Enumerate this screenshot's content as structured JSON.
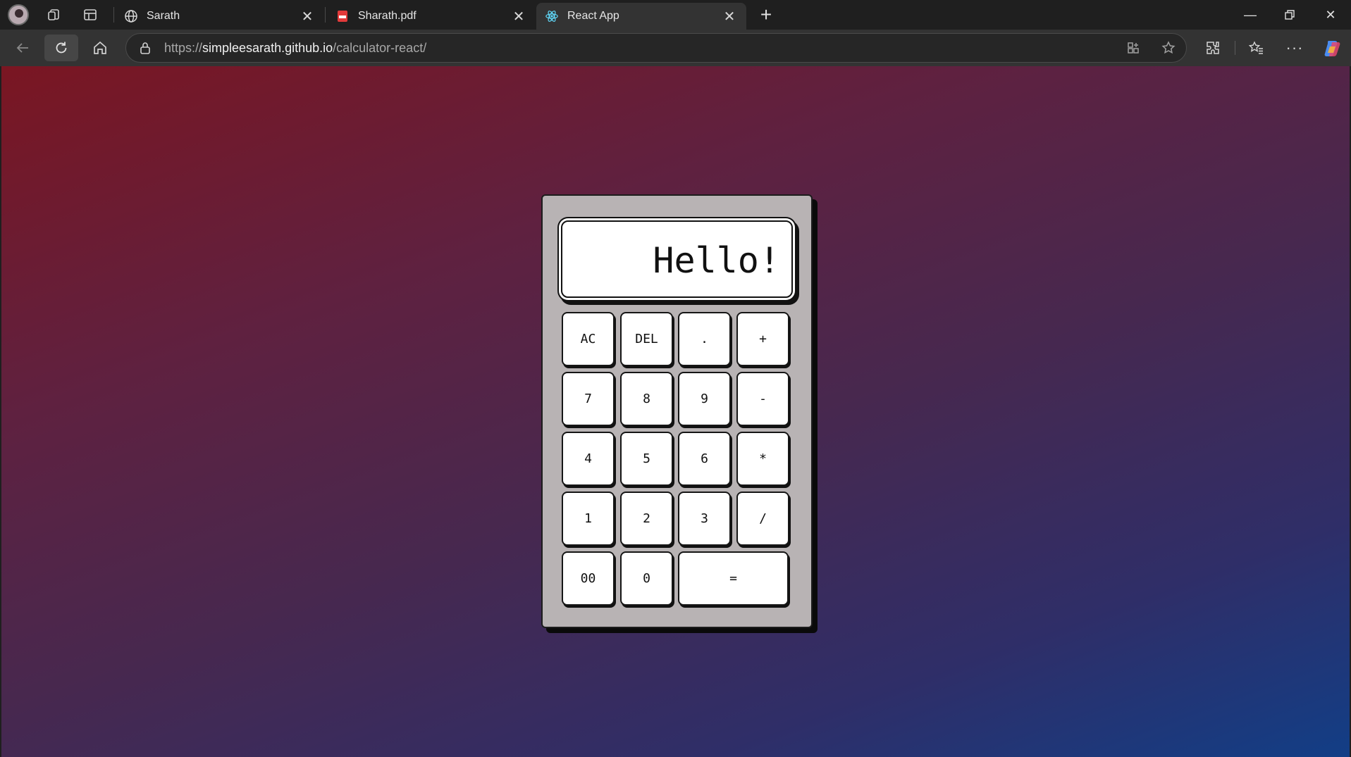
{
  "browser": {
    "tabs": [
      {
        "label": "Sarath",
        "icon": "globe-icon"
      },
      {
        "label": "Sharath.pdf",
        "icon": "pdf-icon"
      },
      {
        "label": "React App",
        "icon": "react-icon",
        "active": true
      }
    ],
    "url": {
      "scheme": "https://",
      "host": "simpleesarath.github.io",
      "path": "/calculator-react/"
    }
  },
  "calculator": {
    "display": "Hello!",
    "keys": [
      [
        "AC",
        "DEL",
        ".",
        "+"
      ],
      [
        "7",
        "8",
        "9",
        "-"
      ],
      [
        "4",
        "5",
        "6",
        "*"
      ],
      [
        "1",
        "2",
        "3",
        "/"
      ],
      [
        "00",
        "0",
        "="
      ]
    ]
  },
  "colors": {
    "gradient_start": "#7a1622",
    "gradient_end": "#123e86",
    "calculator_body": "#b8b3b4",
    "key_background": "#ffffff"
  }
}
